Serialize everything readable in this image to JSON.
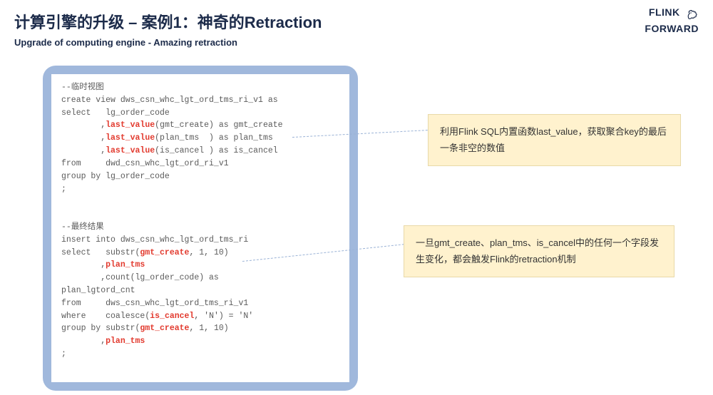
{
  "header": {
    "title": "计算引擎的升级 – 案例1：神奇的Retraction",
    "subtitle": "Upgrade of computing engine - Amazing retraction"
  },
  "logo": {
    "line1": "FLINK",
    "line2": "FORWARD"
  },
  "code": {
    "c01": "--临时视图",
    "c02": "create view dws_csn_whc_lgt_ord_tms_ri_v1 as",
    "c03a": "select   lg_order_code",
    "c04a": "        ,",
    "c04b": "last_value",
    "c04c": "(gmt_create) as gmt_create",
    "c05a": "        ,",
    "c05b": "last_value",
    "c05c": "(plan_tms  ) as plan_tms",
    "c06a": "        ,",
    "c06b": "last_value",
    "c06c": "(is_cancel ) as is_cancel",
    "c07": "from     dwd_csn_whc_lgt_ord_ri_v1",
    "c08": "group by lg_order_code",
    "c09": ";",
    "c10": "",
    "c11": "",
    "c12": "--最终结果",
    "c13": "insert into dws_csn_whc_lgt_ord_tms_ri",
    "c14a": "select   substr(",
    "c14b": "gmt_create",
    "c14c": ", 1, 10)",
    "c15a": "        ,",
    "c15b": "plan_tms",
    "c16": "        ,count(lg_order_code) as",
    "c16b": "plan_lgtord_cnt",
    "c17": "from     dws_csn_whc_lgt_ord_tms_ri_v1",
    "c18a": "where    coalesce(",
    "c18b": "is_cancel",
    "c18c": ", 'N') = 'N'",
    "c19a": "group by substr(",
    "c19b": "gmt_create",
    "c19c": ", 1, 10)",
    "c20a": "        ,",
    "c20b": "plan_tms",
    "c21": ";"
  },
  "callouts": {
    "note1": "利用Flink SQL内置函数last_value，获取聚合key的最后一条非空的数值",
    "note2": "一旦gmt_create、plan_tms、is_cancel中的任何一个字段发生变化，都会触发Flink的retraction机制"
  }
}
